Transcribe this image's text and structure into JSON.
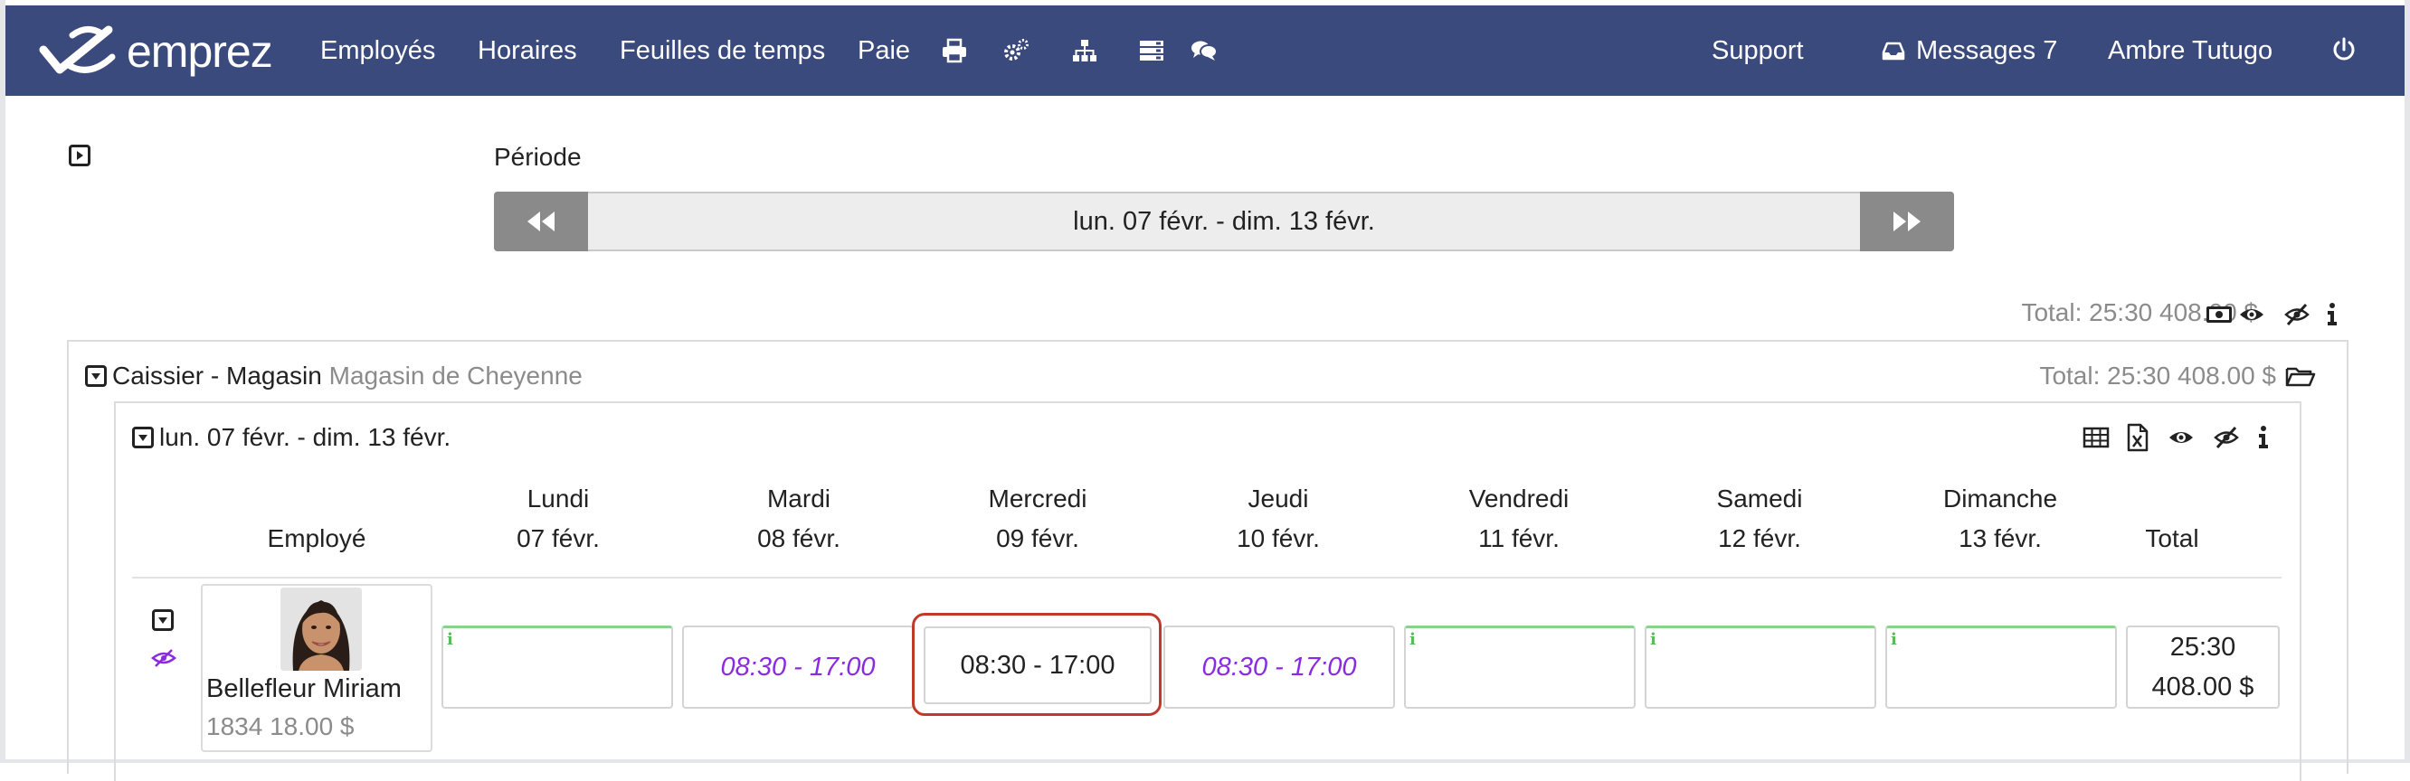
{
  "brand": {
    "name": "emprez"
  },
  "nav": {
    "employees": "Employés",
    "schedules": "Horaires",
    "timesheets": "Feuilles de temps",
    "payroll": "Paie",
    "support": "Support",
    "messages": "Messages 7",
    "user": "Ambre Tutugo"
  },
  "period": {
    "label": "Période",
    "range": "lun. 07 févr. - dim. 13 févr."
  },
  "summary": {
    "total": "Total: 25:30 408.00 $"
  },
  "group": {
    "role": "Caissier - Magasin",
    "location": "Magasin de Cheyenne",
    "total": "Total: 25:30 408.00 $"
  },
  "week": {
    "title": "lun. 07 févr. - dim. 13 févr.",
    "employee_header": "Employé",
    "total_header": "Total",
    "days": [
      {
        "name": "Lundi",
        "date": "07 févr."
      },
      {
        "name": "Mardi",
        "date": "08 févr."
      },
      {
        "name": "Mercredi",
        "date": "09 févr."
      },
      {
        "name": "Jeudi",
        "date": "10 févr."
      },
      {
        "name": "Vendredi",
        "date": "11 févr."
      },
      {
        "name": "Samedi",
        "date": "12 févr."
      },
      {
        "name": "Dimanche",
        "date": "13 févr."
      }
    ]
  },
  "employee": {
    "name": "Bellefleur Miriam",
    "meta": "1834 18.00 $",
    "shifts": [
      "i",
      "08:30 - 17:00",
      "08:30 - 17:00",
      "08:30 - 17:00",
      "i",
      "i",
      "i"
    ],
    "total_hours": "25:30",
    "total_pay": "408.00 $"
  },
  "colors": {
    "navbar": "#3a4a7d",
    "scheduled_shift": "#8a2be2",
    "selected_border": "#c0392b",
    "empty_cell_top": "#8ad18a"
  }
}
